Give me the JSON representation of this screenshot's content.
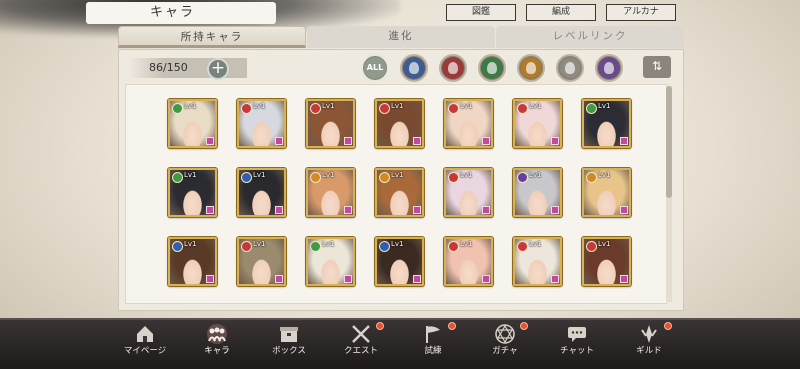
{
  "header": {
    "title": "キャラ",
    "buttons": [
      "図鑑",
      "編成",
      "アルカナ"
    ]
  },
  "tabs": [
    {
      "label": "所持キャラ",
      "active": true
    },
    {
      "label": "進化",
      "active": false
    },
    {
      "label": "レベルリンク",
      "active": false
    }
  ],
  "toolbar": {
    "count": "86/150",
    "plus_icon": "plus-icon",
    "filter_all_label": "ALL",
    "filters": [
      {
        "name": "water-filter",
        "color": "#3e5c93"
      },
      {
        "name": "fire-filter",
        "color": "#9c3a3a"
      },
      {
        "name": "wind-filter",
        "color": "#3e7a44"
      },
      {
        "name": "earth-filter",
        "color": "#b07b2c"
      },
      {
        "name": "light-filter",
        "color": "#8f8a82"
      },
      {
        "name": "dark-filter",
        "color": "#6a4a8a"
      }
    ],
    "sort_icon": "sort-icon"
  },
  "characters": [
    {
      "level": "Lv1",
      "element": "wind",
      "hair": "#e8dcc6"
    },
    {
      "level": "Lv1",
      "element": "fire",
      "hair": "#d7d9e0"
    },
    {
      "level": "Lv1",
      "element": "fire",
      "hair": "#8a5636"
    },
    {
      "level": "Lv1",
      "element": "fire",
      "hair": "#7a4a30"
    },
    {
      "level": "Lv1",
      "element": "fire",
      "hair": "#f0d6c4"
    },
    {
      "level": "Lv1",
      "element": "fire",
      "hair": "#f0d8d8"
    },
    {
      "level": "Lv1",
      "element": "wind",
      "hair": "#2c2c34"
    },
    {
      "level": "Lv1",
      "element": "wind",
      "hair": "#2b2b32"
    },
    {
      "level": "Lv1",
      "element": "water",
      "hair": "#2a2a2e"
    },
    {
      "level": "Lv1",
      "element": "earth",
      "hair": "#d89a6a"
    },
    {
      "level": "Lv1",
      "element": "earth",
      "hair": "#a86a3a"
    },
    {
      "level": "Lv1",
      "element": "fire",
      "hair": "#ead6e0"
    },
    {
      "level": "Lv1",
      "element": "dark",
      "hair": "#c8c8cc"
    },
    {
      "level": "Lv1",
      "element": "earth",
      "hair": "#e8c48a"
    },
    {
      "level": "Lv1",
      "element": "water",
      "hair": "#5a3a26"
    },
    {
      "level": "Lv1",
      "element": "fire",
      "hair": "#9a8a6e"
    },
    {
      "level": "Lv1",
      "element": "wind",
      "hair": "#ece6d8"
    },
    {
      "level": "Lv1",
      "element": "water",
      "hair": "#3a2a22"
    },
    {
      "level": "Lv1",
      "element": "fire",
      "hair": "#f2c2b0"
    },
    {
      "level": "Lv1",
      "element": "fire",
      "hair": "#ece6dc"
    },
    {
      "level": "Lv1",
      "element": "fire",
      "hair": "#6a3a2a"
    }
  ],
  "element_colors": {
    "fire": "#c8373a",
    "water": "#2f5fae",
    "wind": "#3e9a43",
    "earth": "#d48a24",
    "dark": "#6a3ea0"
  },
  "nav": [
    {
      "label": "マイページ",
      "icon": "home-icon",
      "badge": false
    },
    {
      "label": "キャラ",
      "icon": "chara-icon",
      "badge": false,
      "active": true
    },
    {
      "label": "ボックス",
      "icon": "box-icon",
      "badge": false
    },
    {
      "label": "クエスト",
      "icon": "swords-icon",
      "badge": true
    },
    {
      "label": "試練",
      "icon": "flag-icon",
      "badge": true
    },
    {
      "label": "ガチャ",
      "icon": "hexagram-icon",
      "badge": true
    },
    {
      "label": "チャット",
      "icon": "chat-icon",
      "badge": false
    },
    {
      "label": "ギルド",
      "icon": "guild-icon",
      "badge": true
    }
  ]
}
